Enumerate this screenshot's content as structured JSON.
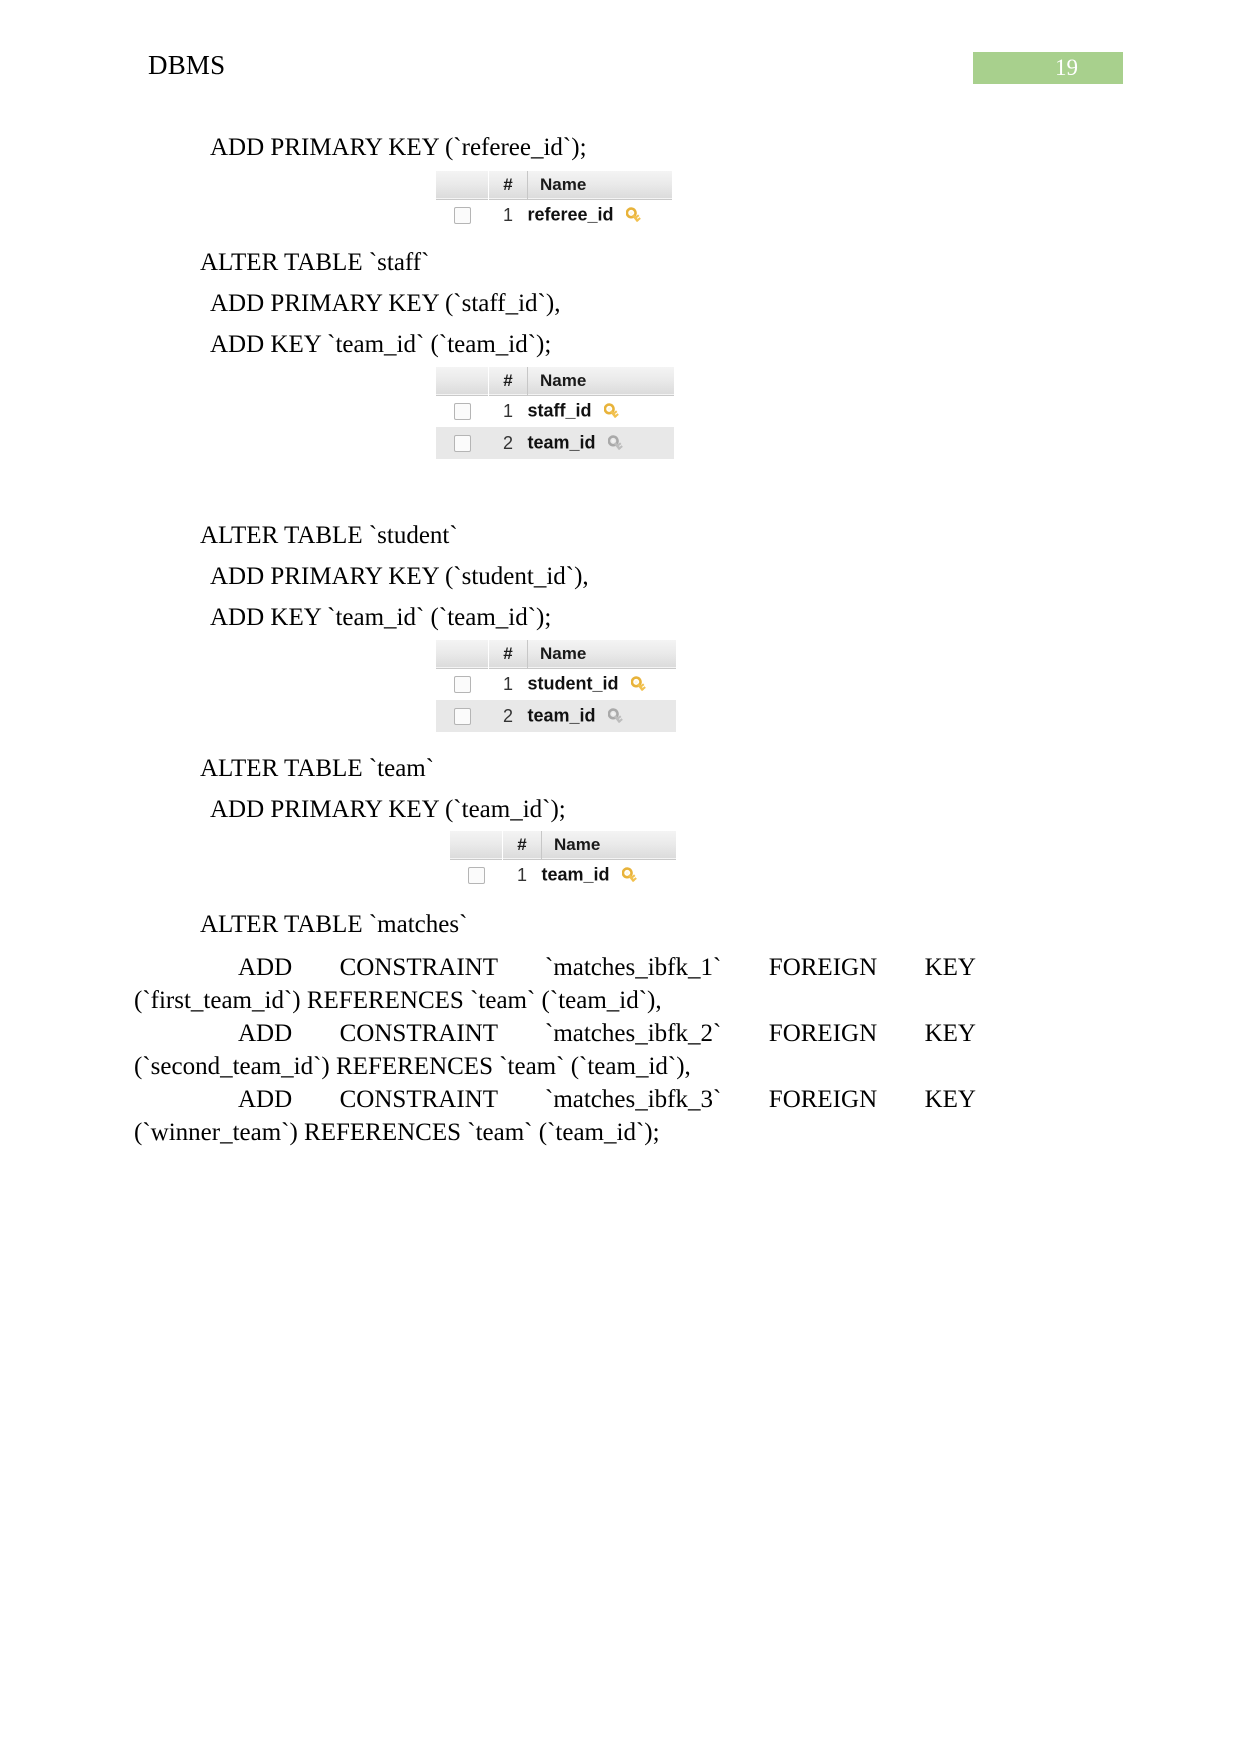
{
  "header": {
    "title": "DBMS",
    "page_number": "19",
    "badge_color": "#a8d08d"
  },
  "body": {
    "line_referee_pk": "ADD PRIMARY KEY (`referee_id`);",
    "staff_alter": "ALTER TABLE `staff`",
    "staff_pk": "ADD PRIMARY KEY (`staff_id`),",
    "staff_key": "ADD KEY `team_id` (`team_id`);",
    "student_alter": "ALTER TABLE `student`",
    "student_pk": "ADD PRIMARY KEY (`student_id`),",
    "student_key": "ADD KEY `team_id` (`team_id`);",
    "team_alter": "ALTER TABLE `team`",
    "team_pk": "ADD PRIMARY KEY (`team_id`);",
    "matches_alter": "ALTER TABLE `matches`",
    "matches_fk1": "ADD CONSTRAINT `matches_ibfk_1` FOREIGN KEY (`first_team_id`) REFERENCES `team` (`team_id`),",
    "matches_fk2": "ADD CONSTRAINT `matches_ibfk_2` FOREIGN KEY (`second_team_id`) REFERENCES `team` (`team_id`),",
    "matches_fk3": "ADD CONSTRAINT `matches_ibfk_3` FOREIGN KEY (`winner_team`) REFERENCES `team` (`team_id`);"
  },
  "tables": {
    "columns": {
      "num": "#",
      "name": "Name"
    },
    "referee": {
      "rows": [
        {
          "num": "1",
          "name": "referee_id",
          "key": "gold"
        }
      ]
    },
    "staff": {
      "rows": [
        {
          "num": "1",
          "name": "staff_id",
          "key": "gold"
        },
        {
          "num": "2",
          "name": "team_id",
          "key": "silver"
        }
      ]
    },
    "student": {
      "rows": [
        {
          "num": "1",
          "name": "student_id",
          "key": "gold"
        },
        {
          "num": "2",
          "name": "team_id",
          "key": "silver"
        }
      ]
    },
    "team": {
      "rows": [
        {
          "num": "1",
          "name": "team_id",
          "key": "gold"
        }
      ]
    }
  }
}
